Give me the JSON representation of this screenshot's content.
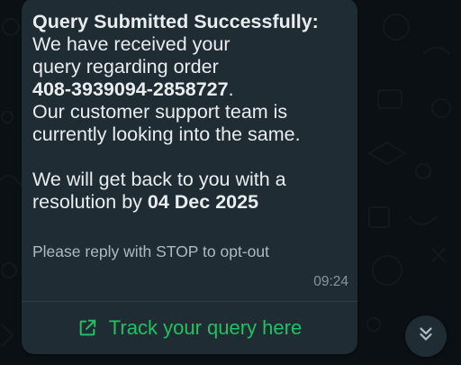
{
  "message": {
    "heading": "Query Submitted Successfully:",
    "line1": "We have received your",
    "line2": "query regarding order",
    "order_number": "408-3939094-2858727",
    "order_suffix": ".",
    "line3": "Our customer support team is",
    "line4": "currently looking into the same.",
    "line5": "We will get back to you with a",
    "line6_prefix": "resolution by ",
    "resolution_date": "04 Dec 2025",
    "optout": "Please reply with STOP to opt-out",
    "time": "09:24"
  },
  "action_button": {
    "label": "Track your query here",
    "icon": "external-link-icon",
    "color": "#21c063"
  },
  "scroll_button": {
    "icon": "double-chevron-down-icon"
  },
  "colors": {
    "bubble": "#1f2c33",
    "background": "#0b1014",
    "text": "#e9edef",
    "accent": "#21c063"
  }
}
